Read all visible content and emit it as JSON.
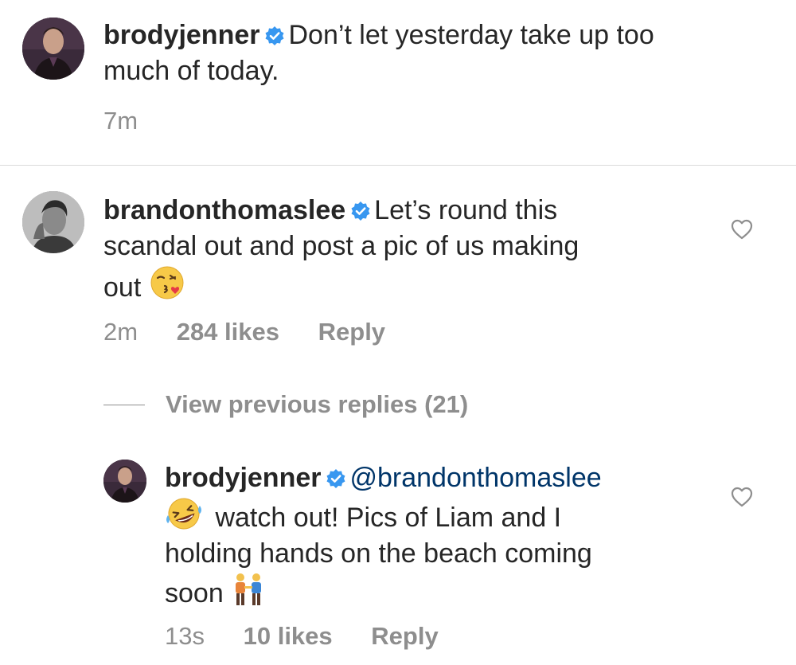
{
  "caption": {
    "username": "brodyjenner",
    "text_line1": "Don’t let yesterday take up too",
    "text_line2": "much of today.",
    "time": "7m"
  },
  "comment": {
    "username": "brandonthomaslee",
    "text_line1": "Let’s round this",
    "text_line2": "scandal out and post a pic of us making",
    "text_line3": "out",
    "emoji": "kissing-face-with-heart-emoji",
    "time": "2m",
    "likes": "284 likes",
    "reply": "Reply"
  },
  "view_previous": "View previous replies (21)",
  "reply_comment": {
    "username": "brodyjenner",
    "mention": "@brandonthomaslee",
    "text_line2": "watch out! Pics of Liam and I",
    "text_line3": "holding hands on the beach coming",
    "text_line4": "soon",
    "emoji1": "rolling-on-floor-laughing-emoji",
    "emoji2": "two-men-holding-hands-emoji",
    "time": "13s",
    "likes": "10 likes",
    "reply": "Reply"
  },
  "colors": {
    "verified": "#3897f0",
    "meta": "#8e8e8e",
    "mention": "#003569",
    "divider": "#dbdbdb"
  }
}
